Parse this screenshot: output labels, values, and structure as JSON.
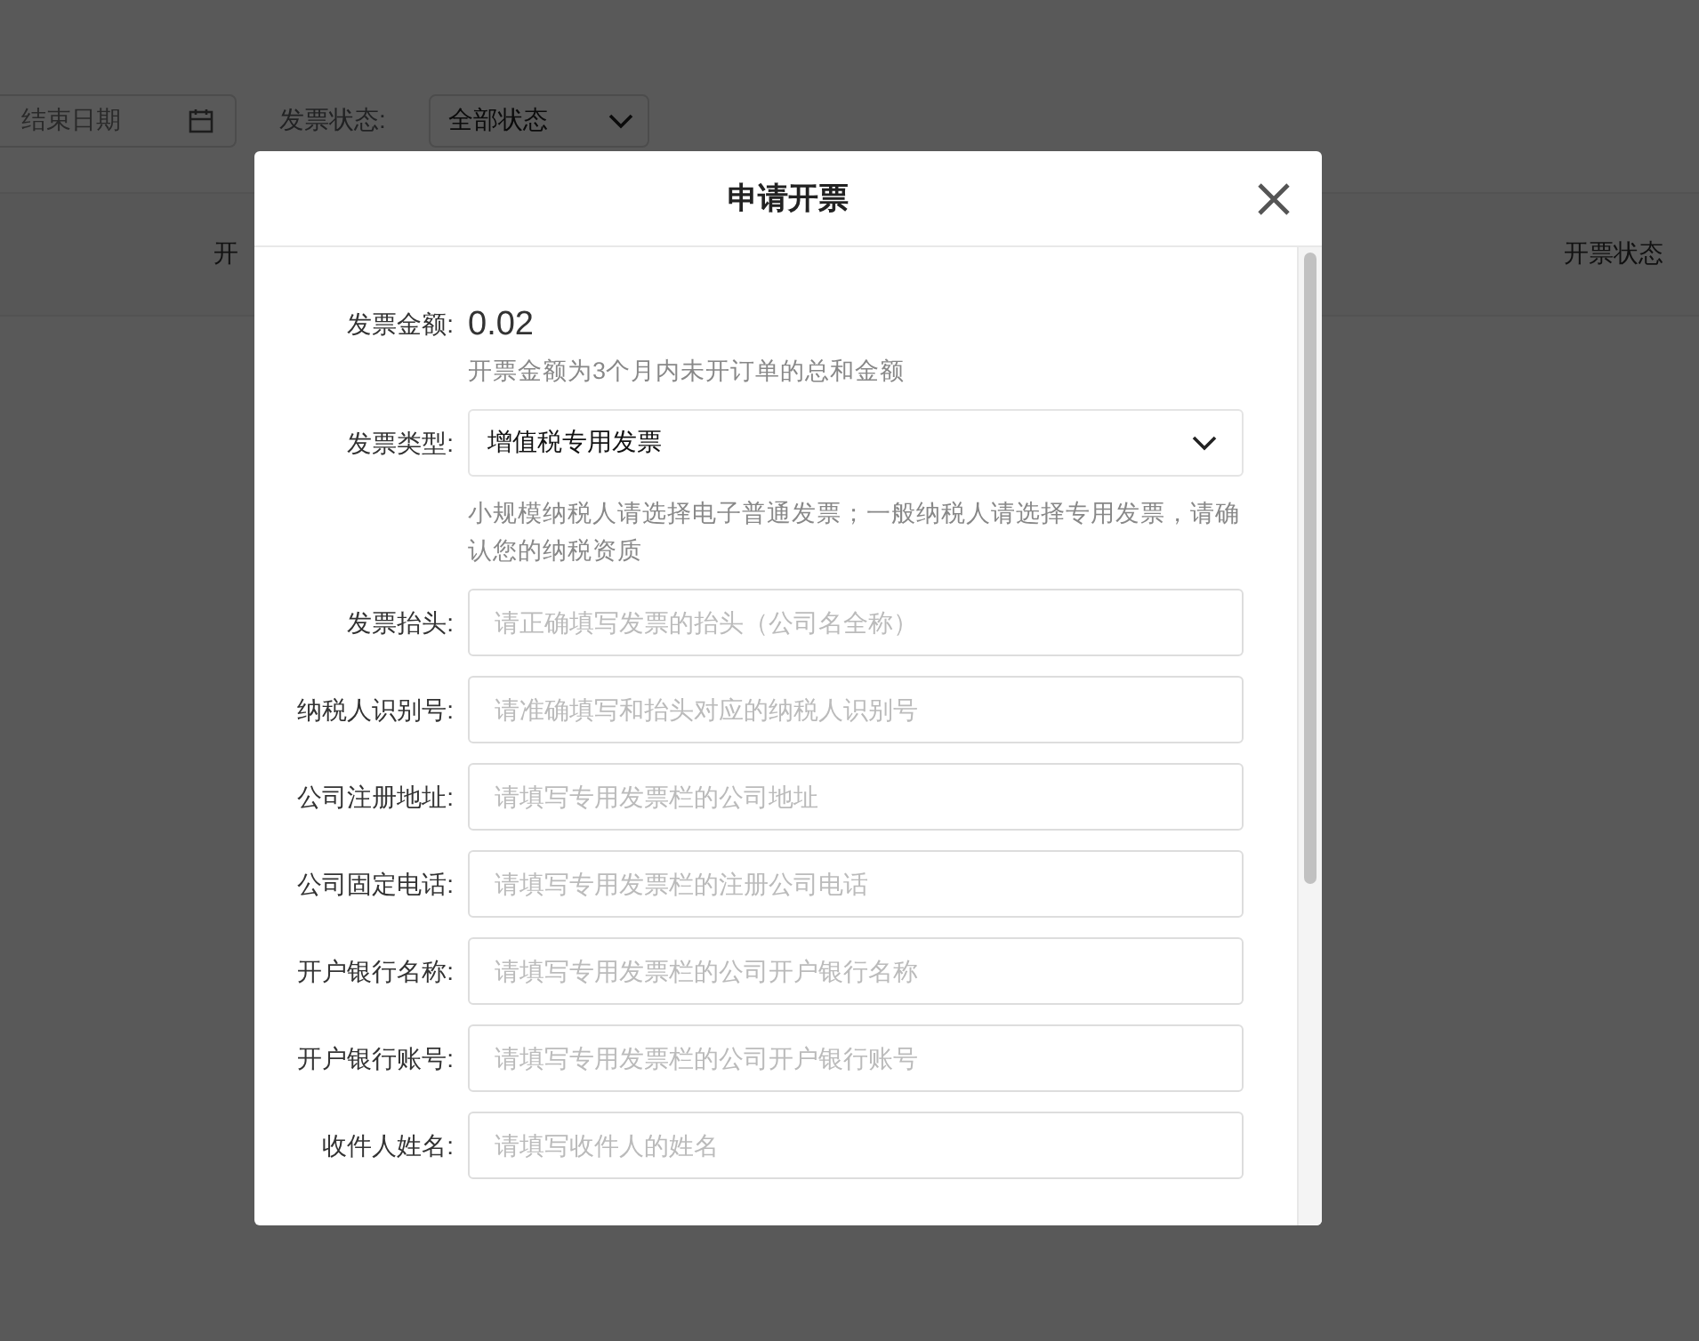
{
  "filters": {
    "end_date": {
      "placeholder": "结束日期"
    },
    "status_label": "发票状态:",
    "status_select": "全部状态"
  },
  "table": {
    "columns": [
      "开",
      "开票状态"
    ]
  },
  "dialog": {
    "title": "申请开票",
    "amount": {
      "label": "发票金额:",
      "value": "0.02",
      "hint": "开票金额为3个月内未开订单的总和金额"
    },
    "type": {
      "label": "发票类型:",
      "value": "增值税专用发票",
      "hint": "小规模纳税人请选择电子普通发票；一般纳税人请选择专用发票，请确认您的纳税资质"
    },
    "fields": [
      {
        "label": "发票抬头:",
        "placeholder": "请正确填写发票的抬头（公司名全称）"
      },
      {
        "label": "纳税人识别号:",
        "placeholder": "请准确填写和抬头对应的纳税人识别号"
      },
      {
        "label": "公司注册地址:",
        "placeholder": "请填写专用发票栏的公司地址"
      },
      {
        "label": "公司固定电话:",
        "placeholder": "请填写专用发票栏的注册公司电话"
      },
      {
        "label": "开户银行名称:",
        "placeholder": "请填写专用发票栏的公司开户银行名称"
      },
      {
        "label": "开户银行账号:",
        "placeholder": "请填写专用发票栏的公司开户银行账号"
      },
      {
        "label": "收件人姓名:",
        "placeholder": "请填写收件人的姓名"
      }
    ]
  }
}
